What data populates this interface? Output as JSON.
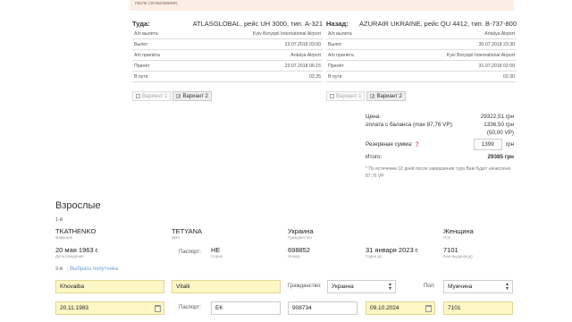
{
  "notice": {
    "text": "после согласования."
  },
  "outbound": {
    "title": "Туда:",
    "flight": "ATLASGLOBAL, рейс UH 3000, тип. A-321",
    "rows": [
      {
        "label": "А/п вылета",
        "value": "Kyiv Boryspil International Airport"
      },
      {
        "label": "Вылет",
        "value": "23.07.2018 03:50"
      },
      {
        "label": "А/п прилёта",
        "value": "Antalya Airport"
      },
      {
        "label": "Прилёт",
        "value": "23.07.2018 06:15"
      },
      {
        "label": "В пути",
        "value": "02:25"
      }
    ],
    "variant1": "Вариант 1",
    "variant2": "Вариант 2"
  },
  "return": {
    "title": "Назад:",
    "flight": "AZURAIR UKRAINE, рейс QU 4412, тип. B-737-800",
    "rows": [
      {
        "label": "А/п вылета",
        "value": "Antalya Airport"
      },
      {
        "label": "Вылет",
        "value": "30.07.2018 23:30"
      },
      {
        "label": "А/п прилёта",
        "value": "Kyiv Boryspil International Airport"
      },
      {
        "label": "Прилёт",
        "value": "31.07.2018 02:00"
      },
      {
        "label": "В пути",
        "value": "02:30"
      }
    ],
    "variant1": "Вариант 1",
    "variant2": "Вариант 2"
  },
  "price": {
    "price_label": "Цена:",
    "price_value": "29322,51 грн",
    "balance_label": "оплата с баланса (max 87,76 VP):",
    "balance_value": "1336,50 грн",
    "balance_sub": "(50,00 VP)",
    "reserve_label": "Резервная сумма:",
    "reserve_value": "1399",
    "reserve_unit": "грн",
    "total_label": "Итого:",
    "total_value": "29385 грн",
    "hint": "* По истечении 10 дней после завершения тура Вам будет начислено 87,76 VP"
  },
  "adults": {
    "title": "Взрослые",
    "p1": {
      "index": "1-й",
      "lastname": "TKATHENKO",
      "lastname_label": "Фамилия",
      "firstname": "TETYANA",
      "firstname_label": "Имя",
      "citizenship": "Украина",
      "citizenship_label": "Гражданство",
      "gender": "Женщина",
      "gender_label": "Пол",
      "birth": "20 мая 1963 г.",
      "birth_label": "Дата рождения",
      "passport_label": "Паспорт:",
      "series": "НЕ",
      "series_label": "Серия",
      "number": "698852",
      "number_label": "Номер",
      "valid": "31 января 2023 г.",
      "valid_label": "Годен до",
      "issued": "7101",
      "issued_label": "Кем выдан(код)"
    },
    "p2": {
      "index": "2-й",
      "choose": "Выбрать попутчика",
      "lastname": "Khovaiba",
      "firstname": "Vitalii",
      "citizenship_label": "Гражданство:",
      "citizenship": "Украина",
      "gender_label": "Пол:",
      "gender": "Мужчина",
      "birth": "20.11.1983",
      "passport_label": "Паспорт:",
      "series": "ЕК",
      "number": "908734",
      "valid": "09.10.2024",
      "issued": "7101"
    }
  }
}
